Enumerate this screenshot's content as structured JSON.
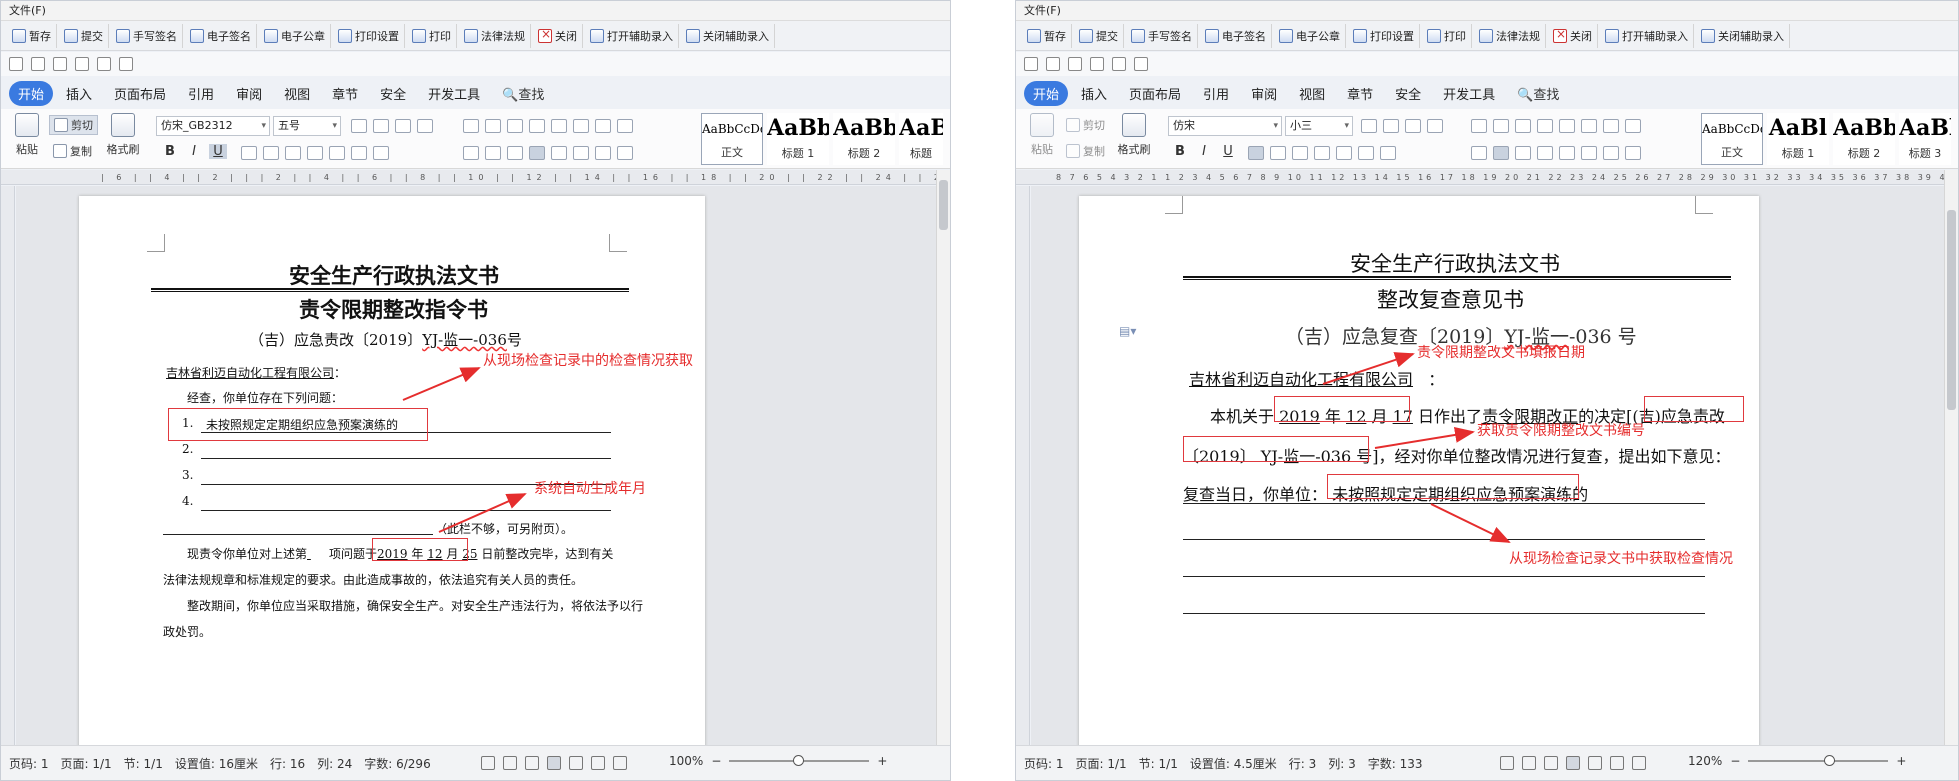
{
  "windows": [
    {
      "id": "left",
      "menu": "文件(F)",
      "plugin_toolbar": [
        "暂存",
        "提交",
        "手写签名",
        "电子签名",
        "电子公章",
        "打印设置",
        "打印",
        "法律法规",
        "关闭",
        "打开辅助录入",
        "关闭辅助录入"
      ],
      "ribbon_tabs": [
        "开始",
        "插入",
        "页面布局",
        "引用",
        "审阅",
        "视图",
        "章节",
        "安全",
        "开发工具"
      ],
      "search_label": "查找",
      "clipboard": {
        "paste": "粘贴",
        "cut": "剪切",
        "copy": "复制",
        "format_painter": "格式刷"
      },
      "font_name": "仿宋_GB2312",
      "font_size": "五号",
      "styles": [
        {
          "preview": "AaBbCcDd",
          "label": "正文"
        },
        {
          "preview": "AaBb",
          "label": "标题 1"
        },
        {
          "preview": "AaBb(",
          "label": "标题 2"
        },
        {
          "preview": "AaB",
          "label": "标题"
        }
      ],
      "ruler_text": "| 6 |   | 4 |   | 2 |   |   | 2 |   | 4 |   | 6 |   | 8 |   | 10 |   | 12 |   | 14 |   | 16 |   | 18 |   | 20 |   | 22 |   | 24 |   | 26 |   | 28 |   | 30 |   | 32 |   | 34 |   | 36 |   | 38 |   | 40 |   | 42 |   | 44 |   | 46 |",
      "document": {
        "title": "安全生产行政执法文书",
        "subtitle": "责令限期整改指令书",
        "doc_number_prefix": "（吉）应急责改〔2019〕",
        "doc_number_code": "YJ-监一-036",
        "doc_number_suffix": "号",
        "recipient": "吉林省利迈自动化工程有限公司",
        "recipient_colon": "：",
        "intro": "经查，你单位存在下列问题：",
        "items": [
          {
            "num": "1.",
            "text": "未按照规定定期组织应急预案演练的"
          },
          {
            "num": "2.",
            "text": ""
          },
          {
            "num": "3.",
            "text": ""
          },
          {
            "num": "4.",
            "text": ""
          }
        ],
        "attach_note": "（此栏不够，可另附页）。",
        "order_p1": "现责令你单位对上述第",
        "order_p2": "项问题于",
        "order_year": "2019",
        "order_year_unit": "年",
        "order_month": "12",
        "order_month_unit": "月",
        "order_day": "25",
        "order_p3": "日前整改完毕，达到有关",
        "order_line2": "法律法规规章和标准规定的要求。由此造成事故的，依法追究有关人员的责任。",
        "order_line3": "整改期间，你单位应当采取措施，确保安全生产。对安全生产违法行为，将依法予以行",
        "order_line4": "政处罚。"
      },
      "annotations": [
        "从现场检查记录中的检查情况获取",
        "系统自动生成年月"
      ],
      "status": [
        "页码: 1",
        "页面: 1/1",
        "节: 1/1",
        "设置值: 16厘米",
        "行: 16",
        "列: 24",
        "字数: 6/296"
      ],
      "zoom": "100%"
    },
    {
      "id": "right",
      "menu": "文件(F)",
      "plugin_toolbar": [
        "暂存",
        "提交",
        "手写签名",
        "电子签名",
        "电子公章",
        "打印设置",
        "打印",
        "法律法规",
        "关闭",
        "打开辅助录入",
        "关闭辅助录入"
      ],
      "ribbon_tabs": [
        "开始",
        "插入",
        "页面布局",
        "引用",
        "审阅",
        "视图",
        "章节",
        "安全",
        "开发工具"
      ],
      "search_label": "查找",
      "clipboard": {
        "paste": "粘贴",
        "cut": "剪切",
        "copy": "复制",
        "format_painter": "格式刷"
      },
      "font_name": "仿宋",
      "font_size": "小三",
      "styles": [
        {
          "preview": "AaBbCcDd",
          "label": "正文"
        },
        {
          "preview": "AaBl",
          "label": "标题 1"
        },
        {
          "preview": "AaBb(",
          "label": "标题 2"
        },
        {
          "preview": "AaBl",
          "label": "标题 3"
        }
      ],
      "ruler_text": "8 7 6 5 4 3 2 1   1 2 3 4 5 6 7 8 9 10 11 12 13 14 15 16 17 18 19 20 21 22 23 24 25 26 27 28 29 30 31 32 33 34 35 36 37 38 39 40 41 42 43 44",
      "document": {
        "title": "安全生产行政执法文书",
        "subtitle": "整改复查意见书",
        "doc_number_prefix": "（吉）应急复查〔2019〕",
        "doc_number_code": "YJ-监一",
        "doc_number_suffix": "-036 号",
        "recipient": "吉林省利迈自动化工程有限公司",
        "recipient_colon": "：",
        "p1_a": "本机关于",
        "p1_year": "2019",
        "p1_year_unit": "年",
        "p1_month": "12",
        "p1_month_unit": "月",
        "p1_day": "17",
        "p1_b": "日作出了",
        "p1_c": "责令限期改正",
        "p1_d": "的决定",
        "p1_ref": "[(吉)应急责改",
        "p2_ref": "〔2019〕 YJ-监一-036 号]",
        "p2_rest": "，经对你单位整改情况进行复查，提出如下意见：",
        "p3_label": "复查当日，你单位：",
        "p3_text": "未按照规定定期组织应急预案演练的"
      },
      "annotations": [
        "责令限期整改文书填报日期",
        "获取责令限期整改文书编号",
        "从现场检查记录文书中获取检查情况"
      ],
      "status": [
        "页码: 1",
        "页面: 1/1",
        "节: 1/1",
        "设置值: 4.5厘米",
        "行: 3",
        "列: 3",
        "字数: 133"
      ],
      "zoom": "120%"
    }
  ]
}
